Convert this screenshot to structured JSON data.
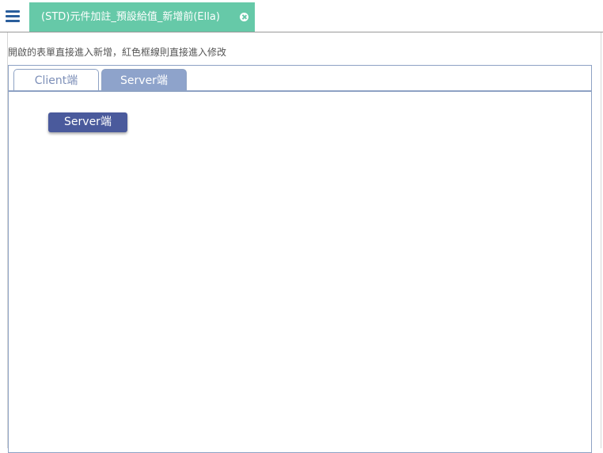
{
  "header": {
    "menu_icon": "hamburger-menu-icon",
    "tab_title": "(STD)元件加註_預設給值_新增前(Ella)",
    "tab_close_icon": "close-circle-icon",
    "accent_color": "#66c9a8"
  },
  "main": {
    "hint_text": "開啟的表單直接進入新增，紅色框線則直接進入修改",
    "tabs": [
      {
        "label": "Client端",
        "active": false
      },
      {
        "label": "Server端",
        "active": true
      }
    ],
    "panel": {
      "button_label": "Server端"
    }
  },
  "colors": {
    "tab_active": "#8ea3cb",
    "tab_inactive_text": "#7d8fb8",
    "button": "#4a5a9c",
    "menu_icon": "#2a5e9c"
  }
}
